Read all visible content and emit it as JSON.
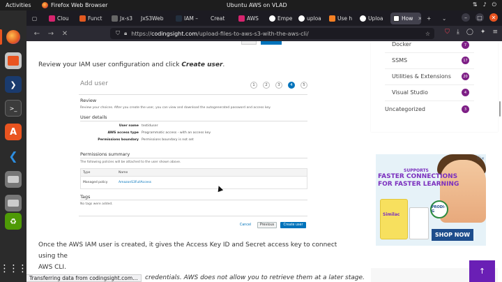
{
  "topbar": {
    "activities": "Activities",
    "app": "Firefox Web Browser",
    "window_title": "Ubuntu AWS on VLAD"
  },
  "tabs": [
    {
      "label": "Clou",
      "color": "#d6246e"
    },
    {
      "label": "Funct",
      "color": "#e25920"
    },
    {
      "label": "Jx-s3",
      "color": "#666"
    },
    {
      "label": "JxS3Web",
      "color": "#333"
    },
    {
      "label": "IAM –",
      "color": "#232f3e"
    },
    {
      "label": "Creat",
      "color": "#444"
    },
    {
      "label": "AWS",
      "color": "#d6246e"
    },
    {
      "label": "Empe",
      "color": "#fff"
    },
    {
      "label": "uploa",
      "color": "#fff"
    },
    {
      "label": "Use h",
      "color": "#f48024"
    },
    {
      "label": "Uploa",
      "color": "#fff"
    },
    {
      "label": "How",
      "color": "#fff"
    }
  ],
  "navbar": {
    "url_prefix": "https://",
    "url_host": "codingsight.com",
    "url_path": "/upload-files-to-aws-s3-with-the-aws-cli/"
  },
  "article": {
    "para1_text": "Review your IAM user configuration and click ",
    "para1_em": "Create user",
    "para1_end": ".",
    "para2_line1": "Once the AWS IAM user is created, it gives the Access Key ID and Secret access key to connect using the",
    "para2_line2": "AWS CLI.",
    "para3": "credentials. AWS does not allow you to retrieve them at a later stage."
  },
  "aws_screenshot": {
    "title": "Add user",
    "steps": [
      "1",
      "2",
      "3",
      "4",
      "5"
    ],
    "review_heading": "Review",
    "review_desc": "Review your choices. After you create the user, you can view and download the autogenerated password and access key.",
    "user_details_heading": "User details",
    "details": [
      {
        "key": "User name",
        "value": "testiduser"
      },
      {
        "key": "AWS access type",
        "value": "Programmatic access - with an access key"
      },
      {
        "key": "Permissions boundary",
        "value": "Permissions boundary is not set"
      }
    ],
    "perm_heading": "Permissions summary",
    "perm_desc": "The following policies will be attached to the user shown above.",
    "col_type": "Type",
    "col_name": "Name",
    "row_type": "Managed policy",
    "row_name": "AmazonS3FullAccess",
    "tags_heading": "Tags",
    "tags_desc": "No tags were added.",
    "cancel": "Cancel",
    "previous": "Previous",
    "create": "Create user"
  },
  "sidebar": {
    "categories": [
      {
        "label": "Docker",
        "count": "7"
      },
      {
        "label": "SSMS",
        "count": "17"
      },
      {
        "label": "Utilities & Extensions",
        "count": "20"
      },
      {
        "label": "Visual Studio",
        "count": "4"
      },
      {
        "label": "Uncategorized",
        "count": "3"
      }
    ]
  },
  "ad": {
    "line1": "SUPPORTS",
    "line2": "FASTER CONNECTIONS",
    "line3": "FOR FASTER LEARNING",
    "brand": "Similac",
    "badge": "PRODI-G",
    "cta": "SHOP NOW"
  },
  "status_text": "Transferring data from codingsight.com…",
  "scroll_top": "↑"
}
